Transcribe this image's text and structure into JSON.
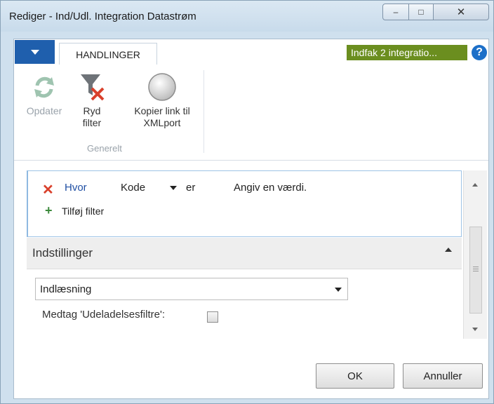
{
  "window": {
    "title": "Rediger - Ind/Udl. Integration Datastrøm",
    "controls": {
      "minimize": "‒",
      "maximize": "□",
      "close": "✕"
    }
  },
  "ribbon": {
    "tab_label": "HANDLINGER",
    "company_badge": "Indfak 2 integratio...",
    "help_symbol": "?",
    "buttons": {
      "refresh": "Opdater",
      "clear_filter": "Ryd filter",
      "copy_link": "Kopier link til XMLport"
    },
    "group_label": "Generelt"
  },
  "filter": {
    "where_label": "Hvor",
    "field": "Kode",
    "operator": "er",
    "value_placeholder": "Angiv en værdi.",
    "add_filter_label": "Tilføj filter"
  },
  "settings": {
    "section_title": "Indstillinger",
    "direction_value": "Indlæsning",
    "include_exclusion_label": "Medtag 'Udeladelsesfiltre':",
    "include_exclusion_checked": false
  },
  "footer": {
    "ok_label": "OK",
    "cancel_label": "Annuller"
  },
  "colors": {
    "accent_blue": "#1f5fad",
    "company_green": "#6b8e1f",
    "clear_red": "#d9402b",
    "add_green": "#3c8a3c"
  }
}
